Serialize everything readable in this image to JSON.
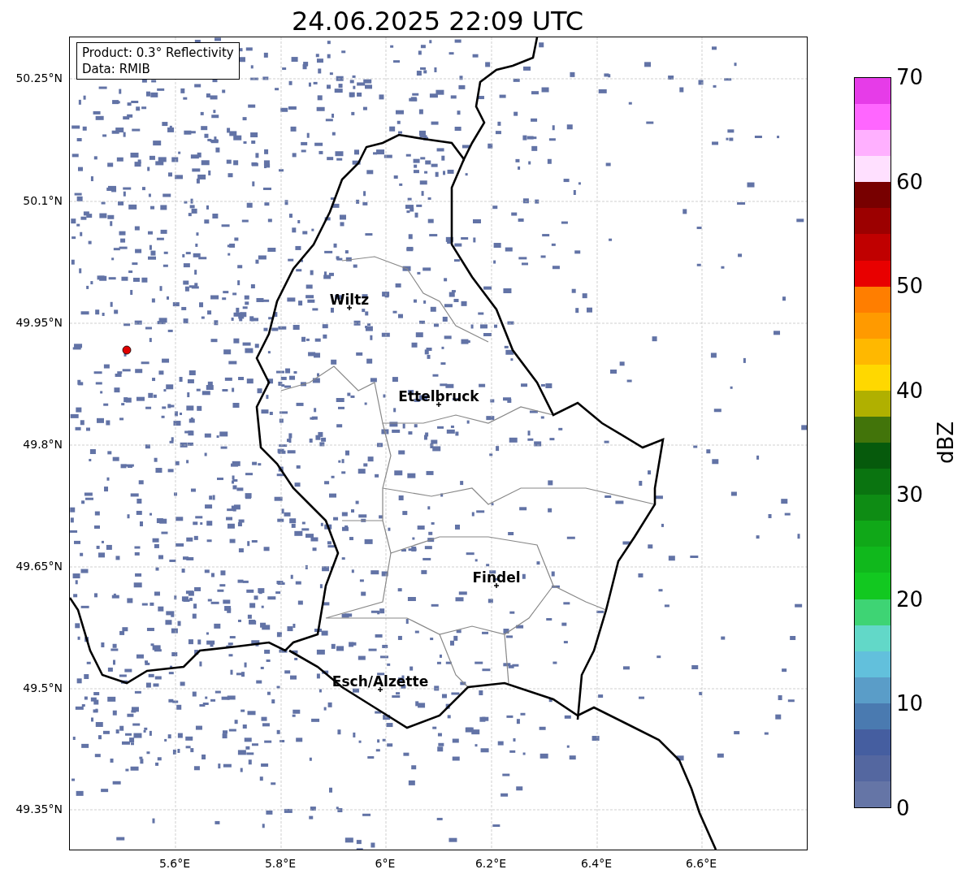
{
  "title": "24.06.2025 22:09 UTC",
  "info_box": [
    "Product: 0.3° Reflectivity",
    "Data: RMIB"
  ],
  "map": {
    "cities": [
      {
        "name": "Wiltz"
      },
      {
        "name": "Ettelbruck"
      },
      {
        "name": "Findel"
      },
      {
        "name": "Esch/Alzette"
      }
    ],
    "lat_ticks": [
      "50.25°N",
      "50.1°N",
      "49.95°N",
      "49.8°N",
      "49.65°N",
      "49.5°N",
      "49.35°N"
    ],
    "lon_ticks": [
      "5.6°E",
      "5.8°E",
      "6°E",
      "6.2°E",
      "6.4°E",
      "6.6°E"
    ]
  },
  "colorbar": {
    "label": "dBZ",
    "ticks": [
      "70",
      "60",
      "50",
      "40",
      "30",
      "20",
      "10",
      "0"
    ],
    "steps": [
      {
        "color": "#e63ce8"
      },
      {
        "color": "#ff66ff"
      },
      {
        "color": "#ffb0ff"
      },
      {
        "color": "#ffe0ff"
      },
      {
        "color": "#780000"
      },
      {
        "color": "#9c0000"
      },
      {
        "color": "#c00000"
      },
      {
        "color": "#e80000"
      },
      {
        "color": "#ff7e00"
      },
      {
        "color": "#ff9a00"
      },
      {
        "color": "#ffb800"
      },
      {
        "color": "#ffd800"
      },
      {
        "color": "#b0b000"
      },
      {
        "color": "#42740a"
      },
      {
        "color": "#065a0c"
      },
      {
        "color": "#0a7410"
      },
      {
        "color": "#0e8c14"
      },
      {
        "color": "#10a818"
      },
      {
        "color": "#10b81c"
      },
      {
        "color": "#12c820"
      },
      {
        "color": "#3ed474"
      },
      {
        "color": "#62d8c8"
      },
      {
        "color": "#62c0dc"
      },
      {
        "color": "#5a9dc8"
      },
      {
        "color": "#4a7ab0"
      },
      {
        "color": "#455ea0"
      },
      {
        "color": "#5467a0"
      },
      {
        "color": "#6575a6"
      }
    ]
  }
}
